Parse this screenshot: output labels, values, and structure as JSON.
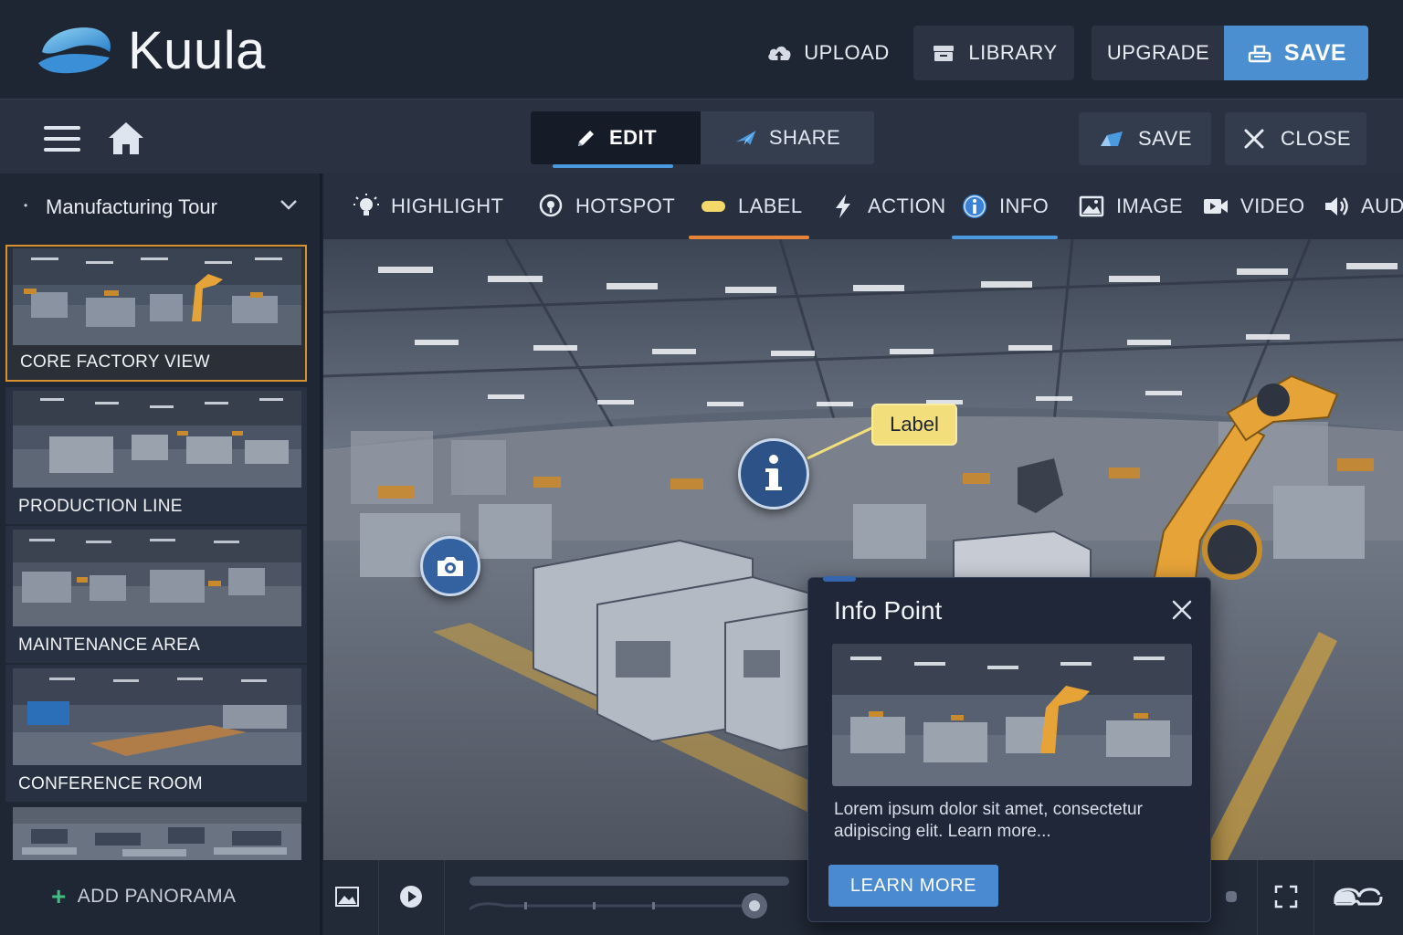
{
  "app": {
    "brand": "Kuula"
  },
  "header": {
    "upload_label": "UPLOAD",
    "library_label": "LIBRARY",
    "upgrade_label": "UPGRADE",
    "save_label": "SAVE"
  },
  "toolbar": {
    "edit_label": "EDIT",
    "share_label": "SHARE",
    "save_label": "SAVE",
    "close_label": "CLOSE"
  },
  "sidebar": {
    "tour_name": "Manufacturing Tour",
    "panoramas": [
      {
        "label": "CORE FACTORY VIEW",
        "active": true
      },
      {
        "label": "PRODUCTION LINE",
        "active": false
      },
      {
        "label": "MAINTENANCE AREA",
        "active": false
      },
      {
        "label": "CONFERENCE ROOM",
        "active": false
      }
    ],
    "add_label": "ADD PANORAMA"
  },
  "tools": [
    {
      "label": "HIGHLIGHT",
      "icon": "lightbulb-icon"
    },
    {
      "label": "HOTSPOT",
      "icon": "hotspot-icon"
    },
    {
      "label": "LABEL",
      "icon": "label-icon",
      "active_color": "#e8843a"
    },
    {
      "label": "ACTION",
      "icon": "lightning-icon"
    },
    {
      "label": "INFO",
      "icon": "info-icon",
      "active_color": "#4b9ae0"
    },
    {
      "label": "IMAGE",
      "icon": "image-icon"
    },
    {
      "label": "VIDEO",
      "icon": "video-icon"
    },
    {
      "label": "AUDIO",
      "icon": "audio-icon"
    }
  ],
  "viewer": {
    "label_text": "Label"
  },
  "popup": {
    "title": "Info Point",
    "body": "Lorem ipsum dolor sit amet, consectetur adipiscing elit. Learn more...",
    "button_label": "LEARN MORE"
  },
  "colors": {
    "accent_blue": "#4b8fd0",
    "active_thumb_border": "#d7922e",
    "label_yellow": "#f2df7c",
    "add_green": "#3fbf7f"
  }
}
